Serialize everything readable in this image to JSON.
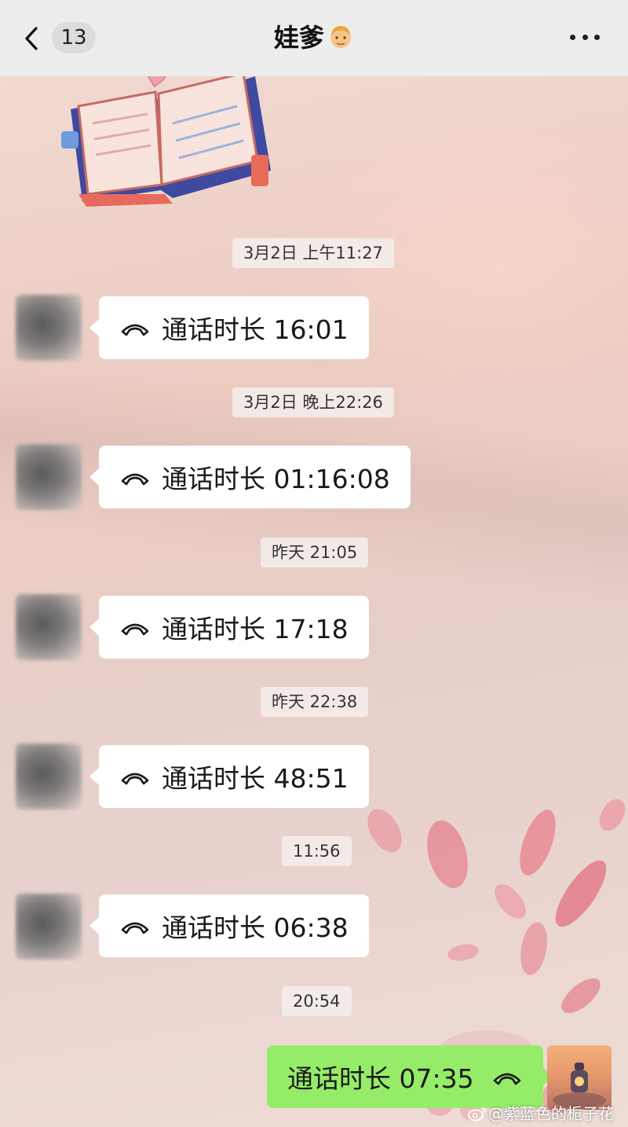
{
  "header": {
    "back_label": "返回",
    "unread_count": "13",
    "title": "娃爹",
    "title_emoji": "man-face-emoji",
    "more_icon": "more-dots-icon"
  },
  "messages": [
    {
      "timestamp": "3月2日 上午11:27",
      "direction": "incoming",
      "text": "通话时长 16:01",
      "icon": "phone-hangup-icon"
    },
    {
      "timestamp": "3月2日 晚上22:26",
      "direction": "incoming",
      "text": "通话时长 01:16:08",
      "icon": "phone-hangup-icon"
    },
    {
      "timestamp": "昨天 21:05",
      "direction": "incoming",
      "text": "通话时长 17:18",
      "icon": "phone-hangup-icon"
    },
    {
      "timestamp": "昨天 22:38",
      "direction": "incoming",
      "text": "通话时长 48:51",
      "icon": "phone-hangup-icon"
    },
    {
      "timestamp": "11:56",
      "direction": "incoming",
      "text": "通话时长 06:38",
      "icon": "phone-hangup-icon"
    },
    {
      "timestamp": "20:54",
      "direction": "outgoing",
      "text": "通话时长 07:35",
      "icon": "phone-hangup-icon"
    }
  ],
  "watermark": "@紫蓝色的栀子花",
  "colors": {
    "header_bg": "#ededed",
    "incoming_bubble": "#ffffff",
    "outgoing_bubble": "#95ec69",
    "chat_bg": "#ebd6cf"
  }
}
